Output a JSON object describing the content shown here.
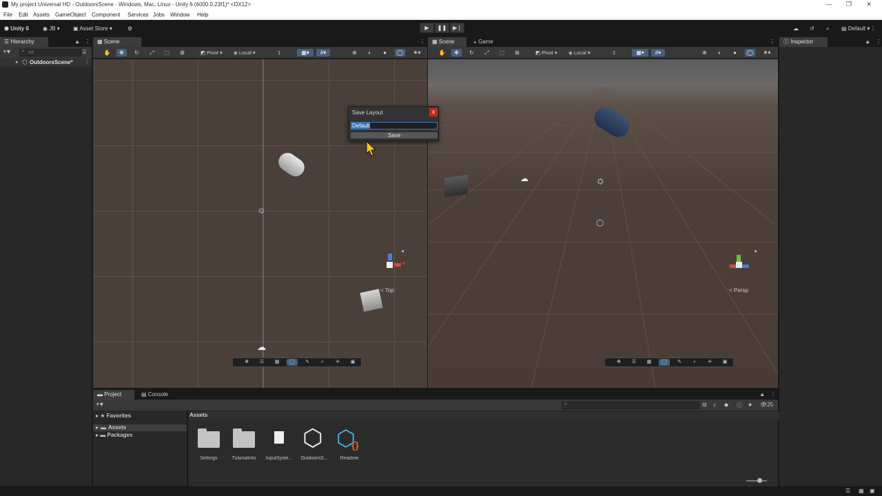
{
  "window": {
    "title": "My project Universal HD - OutdoorsScene - Windows, Mac, Linux - Unity 6 (6000.0.23f1)* <DX12>",
    "min_btn": "—",
    "max_btn": "❐",
    "close_btn": "✕"
  },
  "menu": [
    "File",
    "Edit",
    "Assets",
    "GameObject",
    "Component",
    "Services",
    "Jobs",
    "Window",
    "Help"
  ],
  "toolbar": {
    "unity_label": "Unity 6",
    "account": "JB",
    "asset_store": "Asset Store",
    "layout": "Default",
    "play": "▶",
    "pause": "❚❚",
    "step": "▶❘"
  },
  "hierarchy": {
    "tab": "Hierarchy",
    "search_placeholder": "All",
    "scene_name": "OutdoorsScene*"
  },
  "scene_left": {
    "tab": "Scene",
    "pivot": "Pivot",
    "local": "Local",
    "snap_value": "1",
    "view_label": "< Top"
  },
  "scene_right": {
    "tab_scene": "Scene",
    "tab_game": "Game",
    "pivot": "Pivot",
    "local": "Local",
    "snap_value": "1",
    "view_label": "< Persp"
  },
  "inspector": {
    "tab": "Inspector"
  },
  "dialog": {
    "title": "Save Layout",
    "close": "x",
    "input_value": "Default",
    "save_label": "Save"
  },
  "project": {
    "tab_project": "Project",
    "tab_console": "Console",
    "favorites": "Favorites",
    "assets": "Assets",
    "packages": "Packages",
    "breadcrumb": "Assets",
    "hidden_count": "25",
    "items": [
      {
        "name": "Settings"
      },
      {
        "name": "TutorialInfo"
      },
      {
        "name": "InputSyste..."
      },
      {
        "name": "OutdoorsS..."
      },
      {
        "name": "Readme"
      }
    ]
  },
  "colors": {
    "accent": "#3a79bb",
    "scene_bg": "#4a3f39",
    "panel": "#282828",
    "close_red": "#c42b1c"
  }
}
